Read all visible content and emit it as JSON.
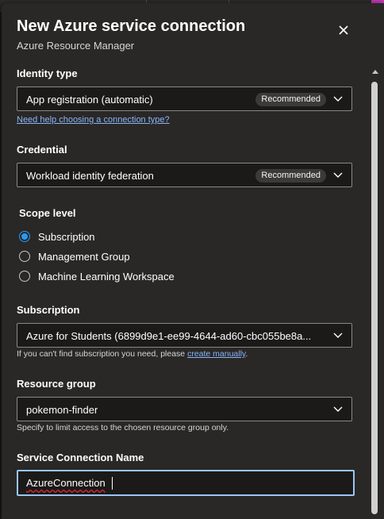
{
  "dialog": {
    "title": "New Azure service connection",
    "subtitle": "Azure Resource Manager"
  },
  "identity_type": {
    "label": "Identity type",
    "value": "App registration (automatic)",
    "badge": "Recommended",
    "help_link": "Need help choosing a connection type?"
  },
  "credential": {
    "label": "Credential",
    "value": "Workload identity federation",
    "badge": "Recommended"
  },
  "scope_level": {
    "label": "Scope level",
    "options": [
      {
        "label": "Subscription",
        "checked": true
      },
      {
        "label": "Management Group",
        "checked": false
      },
      {
        "label": "Machine Learning Workspace",
        "checked": false
      }
    ]
  },
  "subscription": {
    "label": "Subscription",
    "value": "Azure for Students (6899d9e1-ee99-4644-ad60-cbc055be8a...",
    "help_text": "If you can't find subscription you need, please",
    "help_link": "create manually",
    "help_suffix": "."
  },
  "resource_group": {
    "label": "Resource group",
    "value": "pokemon-finder",
    "help_text": "Specify to limit access to the chosen resource group only."
  },
  "service_connection_name": {
    "label": "Service Connection Name",
    "value": "AzureConnection"
  },
  "colors": {
    "accent": "#2899f5",
    "link": "#8ab4f8",
    "panel_bg": "#292827",
    "field_bg": "#1b1a19"
  }
}
